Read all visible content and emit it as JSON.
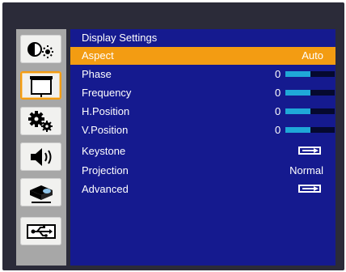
{
  "sidebar": {
    "tabs": [
      {
        "name": "picture-tab",
        "icon": "contrast-brightness-icon"
      },
      {
        "name": "display-tab",
        "icon": "screen-icon",
        "selected": true
      },
      {
        "name": "settings-tab",
        "icon": "gears-icon"
      },
      {
        "name": "volume-tab",
        "icon": "speaker-icon"
      },
      {
        "name": "projector-tab",
        "icon": "projector-icon"
      },
      {
        "name": "usb-tab",
        "icon": "usb-icon"
      }
    ]
  },
  "panel": {
    "title": "Display Settings",
    "rows": [
      {
        "label": "Aspect",
        "type": "value",
        "value": "Auto",
        "selected": true
      },
      {
        "label": "Phase",
        "type": "slider",
        "value": "0",
        "level": 0.5
      },
      {
        "label": "Frequency",
        "type": "slider",
        "value": "0",
        "level": 0.5
      },
      {
        "label": "H.Position",
        "type": "slider",
        "value": "0",
        "level": 0.5
      },
      {
        "label": "V.Position",
        "type": "slider",
        "value": "0",
        "level": 0.5
      },
      {
        "label": "Keystone",
        "type": "enter"
      },
      {
        "label": "Projection",
        "type": "value",
        "value": "Normal"
      },
      {
        "label": "Advanced",
        "type": "enter"
      }
    ]
  },
  "colors": {
    "highlight": "#f39c12",
    "panel": "#151a8f",
    "slider_fill": "#1fa8d8"
  }
}
